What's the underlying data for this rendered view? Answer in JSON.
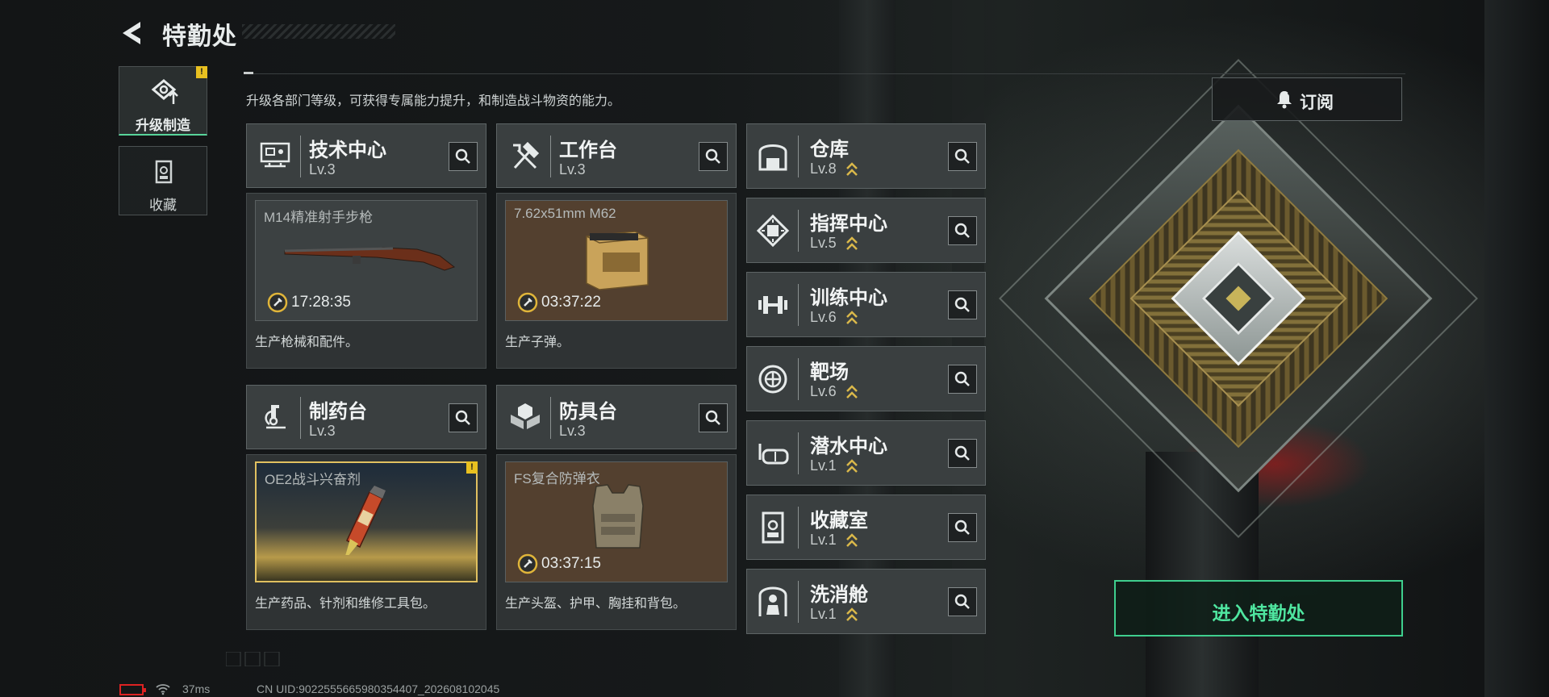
{
  "header": {
    "title": "特勤处",
    "subtitle": "升级各部门等级，可获得专属能力提升，和制造战斗物资的能力。"
  },
  "nav": [
    {
      "label": "升级制造",
      "icon": "upgrade-icon",
      "active": true,
      "badge": "!"
    },
    {
      "label": "收藏",
      "icon": "collection-icon",
      "active": false
    }
  ],
  "cards": [
    {
      "name": "技术中心",
      "level": "Lv.3",
      "icon": "tech-center-icon",
      "product": "M14精准射手步枪",
      "timer": "17:28:35",
      "desc": "生产枪械和配件。"
    },
    {
      "name": "工作台",
      "level": "Lv.3",
      "icon": "workbench-icon",
      "product": "7.62x51mm M62",
      "timer": "03:37:22",
      "desc": "生产子弹。"
    },
    {
      "name": "制药台",
      "level": "Lv.3",
      "icon": "pharmacy-icon",
      "product": "OE2战斗兴奋剂",
      "timer": "",
      "badge": "!",
      "desc": "生产药品、针剂和维修工具包。"
    },
    {
      "name": "防具台",
      "level": "Lv.3",
      "icon": "armor-bench-icon",
      "product": "FS复合防弹衣",
      "timer": "03:37:15",
      "desc": "生产头盔、护甲、胸挂和背包。"
    }
  ],
  "list": [
    {
      "name": "仓库",
      "level": "Lv.8",
      "icon": "warehouse-icon"
    },
    {
      "name": "指挥中心",
      "level": "Lv.5",
      "icon": "command-center-icon"
    },
    {
      "name": "训练中心",
      "level": "Lv.6",
      "icon": "training-center-icon"
    },
    {
      "name": "靶场",
      "level": "Lv.6",
      "icon": "shooting-range-icon"
    },
    {
      "name": "潜水中心",
      "level": "Lv.1",
      "icon": "diving-center-icon"
    },
    {
      "name": "收藏室",
      "level": "Lv.1",
      "icon": "collection-room-icon"
    },
    {
      "name": "洗消舱",
      "level": "Lv.1",
      "icon": "decontamination-icon"
    }
  ],
  "buttons": {
    "subscribe": "订阅",
    "enter": "进入特勤处"
  },
  "status": {
    "ping": "37ms",
    "uid": "CN UID:9022555665980354407_202608102045"
  },
  "colors": {
    "accent_green": "#4fe6a0",
    "upgrade_gold": "#d9b84a",
    "badge_yellow": "#e8c020",
    "battery_red": "#dd2222"
  }
}
